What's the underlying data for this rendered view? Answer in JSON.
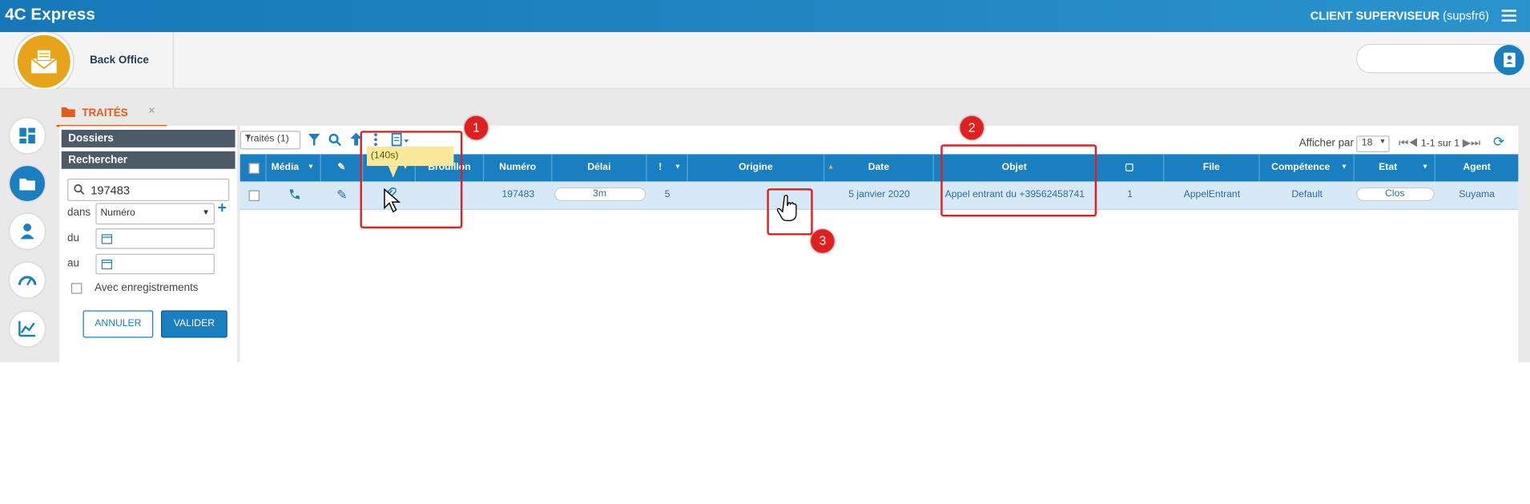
{
  "app": {
    "title": "4C Express",
    "user_name": "CLIENT SUPERVISEUR",
    "user_id": "(supsfr6)"
  },
  "subbar": {
    "module": "Back Office"
  },
  "tab": {
    "label": "TRAITÉS",
    "close": "×"
  },
  "left_panel": {
    "dossiers": "Dossiers",
    "rechercher": "Rechercher",
    "search_value": "197483",
    "dans_label": "dans",
    "dans_value": "Numéro",
    "du_label": "du",
    "au_label": "au",
    "avec_enregistrements": "Avec enregistrements",
    "annuler": "ANNULER",
    "valider": "VALIDER"
  },
  "toolbar": {
    "filter_value": "Traités (1)"
  },
  "pager": {
    "afficher_par": "Afficher par",
    "per_page": "18",
    "range": "1-1 sur 1"
  },
  "table": {
    "headers": {
      "media": "Média",
      "brouillon": "Brouillon",
      "numero": "Numéro",
      "delai": "Délai",
      "bang": "!",
      "origine": "Origine",
      "date": "Date",
      "objet": "Objet",
      "file": "File",
      "competence": "Compétence",
      "etat": "Etat",
      "agent": "Agent"
    },
    "row": {
      "numero": "197483",
      "delai": "3m",
      "bang": "5",
      "date": "5 janvier 2020",
      "objet": "Appel entrant du +39562458741",
      "docs": "1",
      "file": "AppelEntrant",
      "competence": "Default",
      "etat": "Clos",
      "agent": "Suyama"
    }
  },
  "tooltip": "(140s)",
  "annotations": {
    "b1": "1",
    "b2": "2",
    "b3": "3"
  },
  "colors": {
    "primary": "#1a7fc1",
    "accent": "#e05c1b",
    "highlight": "#e02020",
    "logo": "#e7a41a"
  }
}
